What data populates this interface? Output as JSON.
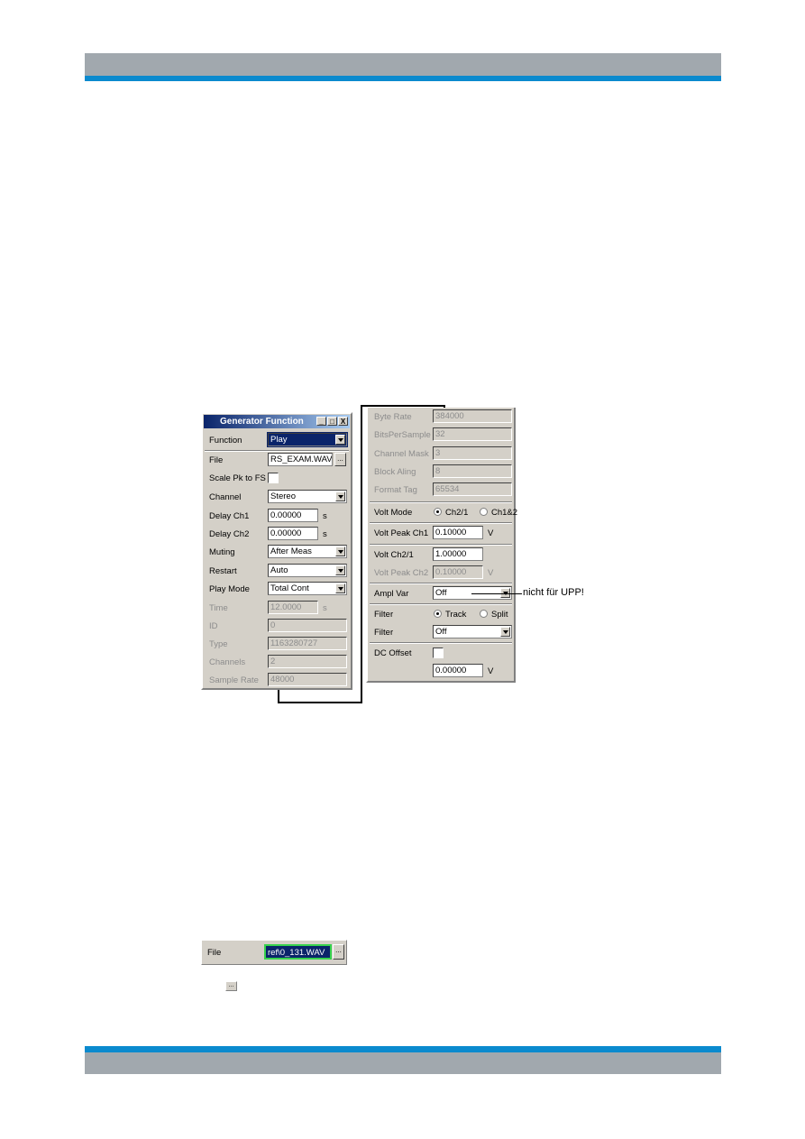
{
  "colors": {
    "band_gray": "#a1a8ae",
    "band_blue": "#0b8ace",
    "title_bar": "#0a246a",
    "highlight_green": "#37d24d"
  },
  "left_panel": {
    "title": "Generator Function",
    "window_buttons": {
      "minimize": "_",
      "maximize": "□",
      "close": "X"
    },
    "rows": {
      "function": {
        "label": "Function",
        "value": "Play"
      },
      "file": {
        "label": "File",
        "value": "RS_EXAM.WAV",
        "browse": "..."
      },
      "scale": {
        "label": "Scale Pk to FS",
        "checked": false
      },
      "channel": {
        "label": "Channel",
        "value": "Stereo"
      },
      "delay1": {
        "label": "Delay Ch1",
        "value": "0.00000",
        "unit": "s"
      },
      "delay2": {
        "label": "Delay Ch2",
        "value": "0.00000",
        "unit": "s"
      },
      "muting": {
        "label": "Muting",
        "value": "After Meas"
      },
      "restart": {
        "label": "Restart",
        "value": "Auto"
      },
      "playmode": {
        "label": "Play Mode",
        "value": "Total Cont"
      },
      "time": {
        "label": "Time",
        "value": "12.0000",
        "unit": "s"
      },
      "id": {
        "label": "ID",
        "value": "0"
      },
      "type": {
        "label": "Type",
        "value": "1163280727"
      },
      "channels": {
        "label": "Channels",
        "value": "2"
      },
      "samplerate": {
        "label": "Sample Rate",
        "value": "48000"
      }
    }
  },
  "right_panel": {
    "rows": {
      "byterate": {
        "label": "Byte Rate",
        "value": "384000"
      },
      "bits": {
        "label": "BitsPerSample",
        "value": "32"
      },
      "mask": {
        "label": "Channel Mask",
        "value": "3"
      },
      "block": {
        "label": "Block Aling",
        "value": "8"
      },
      "format": {
        "label": "Format Tag",
        "value": "65534"
      },
      "voltmode": {
        "label": "Volt Mode",
        "options": [
          "Ch2/1",
          "Ch1&2"
        ],
        "selected": "Ch2/1"
      },
      "voltpeak1": {
        "label": "Volt Peak Ch1",
        "value": "0.10000",
        "unit": "V"
      },
      "voltch21": {
        "label": "Volt Ch2/1",
        "value": "1.00000"
      },
      "voltpeak2": {
        "label": "Volt Peak Ch2",
        "value": "0.10000",
        "unit": "V"
      },
      "amplvar": {
        "label": "Ampl Var",
        "value": "Off"
      },
      "filtermode": {
        "label": "Filter",
        "options": [
          "Track",
          "Split"
        ],
        "selected": "Track"
      },
      "filter": {
        "label": "Filter",
        "value": "Off"
      },
      "dcoffset": {
        "label": "DC Offset",
        "checked": false,
        "value": "0.00000",
        "unit": "V"
      }
    }
  },
  "annotation": "nicht für UPP!",
  "file_strip": {
    "label": "File",
    "value": "ref\\0_131.WAV",
    "browse": "..."
  },
  "small_button": "..."
}
